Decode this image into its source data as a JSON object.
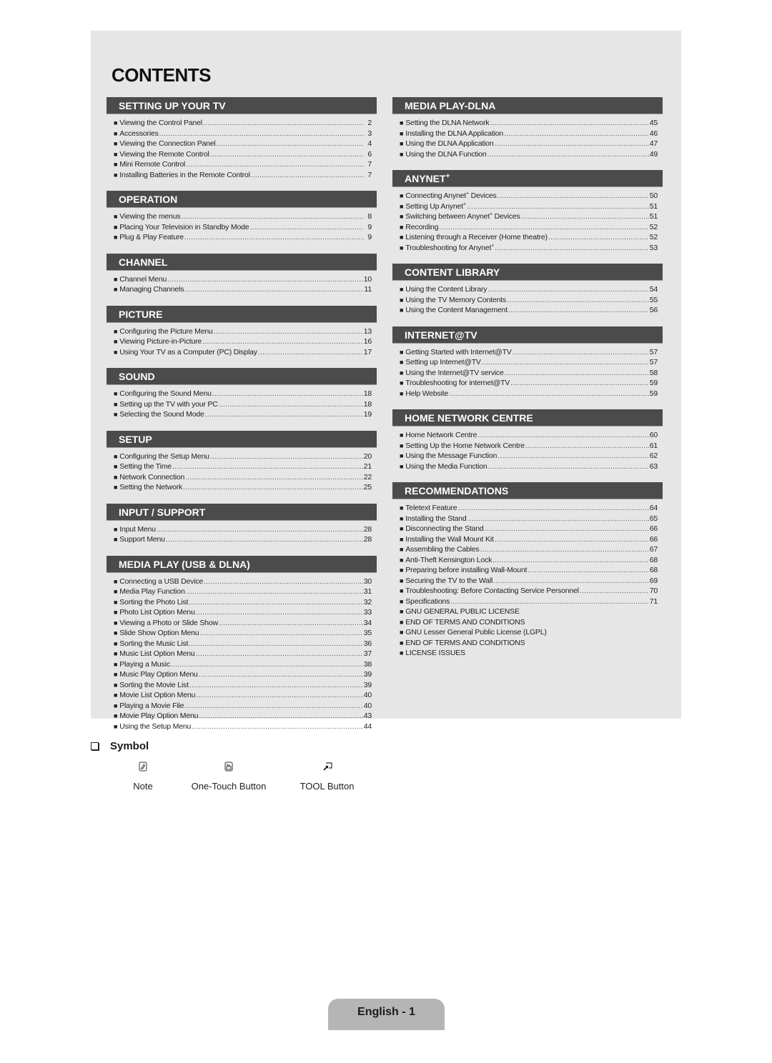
{
  "page_title": "CONTENTS",
  "bullet": "■",
  "left_column": [
    {
      "heading": "SETTING UP YOUR TV",
      "items": [
        {
          "label": "Viewing the Control Panel",
          "page": "2"
        },
        {
          "label": "Accessories",
          "page": "3"
        },
        {
          "label": "Viewing the Connection Panel",
          "page": "4"
        },
        {
          "label": "Viewing the Remote Control",
          "page": "6"
        },
        {
          "label": "Mini Remote Control",
          "page": "7"
        },
        {
          "label": "Installing Batteries in the Remote Control",
          "page": "7"
        }
      ]
    },
    {
      "heading": "OPERATION",
      "items": [
        {
          "label": "Viewing the menus",
          "page": "8"
        },
        {
          "label": "Placing Your Television in Standby Mode",
          "page": "9"
        },
        {
          "label": "Plug & Play Feature",
          "page": "9"
        }
      ]
    },
    {
      "heading": "CHANNEL",
      "items": [
        {
          "label": "Channel Menu",
          "page": "10"
        },
        {
          "label": "Managing Channels",
          "page": "11"
        }
      ]
    },
    {
      "heading": "PICTURE",
      "items": [
        {
          "label": "Configuring the Picture Menu",
          "page": "13"
        },
        {
          "label": "Viewing Picture-in-Picture",
          "page": "16"
        },
        {
          "label": "Using Your TV as a Computer (PC) Display",
          "page": "17"
        }
      ]
    },
    {
      "heading": "SOUND",
      "items": [
        {
          "label": "Configuring the Sound Menu",
          "page": "18"
        },
        {
          "label": "Setting up the TV with your PC",
          "page": "18"
        },
        {
          "label": "Selecting the Sound Mode",
          "page": "19"
        }
      ]
    },
    {
      "heading": "SETUP",
      "items": [
        {
          "label": "Configuring the Setup Menu",
          "page": "20"
        },
        {
          "label": "Setting the Time",
          "page": "21"
        },
        {
          "label": "Network Connection",
          "page": "22"
        },
        {
          "label": "Setting the Network",
          "page": "25"
        }
      ]
    },
    {
      "heading": "INPUT / SUPPORT",
      "items": [
        {
          "label": "Input Menu",
          "page": "28"
        },
        {
          "label": "Support Menu",
          "page": "28"
        }
      ]
    },
    {
      "heading": "MEDIA PLAY (USB & DLNA)",
      "items": [
        {
          "label": "Connecting a USB Device",
          "page": "30"
        },
        {
          "label": "Media Play Function",
          "page": "31"
        },
        {
          "label": "Sorting the Photo List",
          "page": "32"
        },
        {
          "label": "Photo List Option Menu",
          "page": "33"
        },
        {
          "label": "Viewing a Photo or Slide Show",
          "page": "34"
        },
        {
          "label": "Slide Show Option Menu",
          "page": "35"
        },
        {
          "label": "Sorting the Music List",
          "page": "36"
        },
        {
          "label": "Music List Option Menu",
          "page": "37"
        },
        {
          "label": "Playing a Music",
          "page": "38"
        },
        {
          "label": "Music Play Option Menu",
          "page": "39"
        },
        {
          "label": "Sorting the Movie List",
          "page": "39"
        },
        {
          "label": "Movie List Option Menu",
          "page": "40"
        },
        {
          "label": "Playing a Movie File",
          "page": "40"
        },
        {
          "label": "Movie Play Option Menu",
          "page": "43"
        },
        {
          "label": "Using the Setup Menu",
          "page": "44"
        }
      ]
    }
  ],
  "right_column": [
    {
      "heading": "MEDIA PLAY-DLNA",
      "items": [
        {
          "label": "Setting the DLNA Network",
          "page": "45"
        },
        {
          "label": "Installing the DLNA Application",
          "page": "46"
        },
        {
          "label": "Using the DLNA Application",
          "page": "47"
        },
        {
          "label": "Using the DLNA Function",
          "page": "49"
        }
      ]
    },
    {
      "heading": "ANYNET",
      "heading_sup": "+",
      "items": [
        {
          "label": "Connecting Anynet",
          "sup": "+",
          "suffix": " Devices",
          "page": "50"
        },
        {
          "label": "Setting Up Anynet",
          "sup": "+",
          "suffix": "",
          "page": "51"
        },
        {
          "label": "Switching between Anynet",
          "sup": "+",
          "suffix": " Devices",
          "page": "51"
        },
        {
          "label": "Recording",
          "page": "52"
        },
        {
          "label": "Listening through a Receiver (Home theatre)",
          "page": "52"
        },
        {
          "label": "Troubleshooting for Anynet",
          "sup": "+",
          "suffix": "",
          "page": "53"
        }
      ]
    },
    {
      "heading": "CONTENT LIBRARY",
      "items": [
        {
          "label": "Using the Content Library",
          "page": "54"
        },
        {
          "label": "Using the TV Memory Contents",
          "page": "55"
        },
        {
          "label": "Using the Content Management",
          "page": "56"
        }
      ]
    },
    {
      "heading": "INTERNET@TV",
      "items": [
        {
          "label": "Getting Started with Internet@TV",
          "page": "57"
        },
        {
          "label": "Setting up Internet@TV",
          "page": "57"
        },
        {
          "label": "Using the Internet@TV service",
          "page": "58"
        },
        {
          "label": "Troubleshooting for internet@TV",
          "page": "59"
        },
        {
          "label": "Help Website",
          "page": "59"
        }
      ]
    },
    {
      "heading": "HOME NETWORK CENTRE",
      "items": [
        {
          "label": "Home Network Centre",
          "page": "60"
        },
        {
          "label": "Setting Up the Home Network Centre",
          "page": "61"
        },
        {
          "label": "Using the Message Function",
          "page": "62"
        },
        {
          "label": "Using the Media Function",
          "page": "63"
        }
      ]
    },
    {
      "heading": "RECOMMENDATIONS",
      "items": [
        {
          "label": "Teletext Feature",
          "page": "64"
        },
        {
          "label": "Installing the Stand",
          "page": "65"
        },
        {
          "label": "Disconnecting the Stand",
          "page": "66"
        },
        {
          "label": "Installing the Wall Mount Kit",
          "page": "66"
        },
        {
          "label": "Assembling the Cables",
          "page": "67"
        },
        {
          "label": "Anti-Theft Kensington Lock",
          "page": "68"
        },
        {
          "label": "Preparing before installing Wall-Mount",
          "page": "68"
        },
        {
          "label": "Securing the TV to the Wall",
          "page": "69"
        },
        {
          "label": "Troubleshooting: Before Contacting Service Personnel",
          "page": "70"
        },
        {
          "label": "Specifications",
          "page": "71"
        },
        {
          "label": "GNU GENERAL PUBLIC LICENSE"
        },
        {
          "label": "END OF TERMS AND CONDITIONS"
        },
        {
          "label": "GNU Lesser General Public License (LGPL)"
        },
        {
          "label": "END OF TERMS AND CONDITIONS"
        },
        {
          "label": "LICENSE ISSUES"
        }
      ]
    }
  ],
  "symbol": {
    "heading": "Symbol",
    "items": [
      {
        "icon": "note-icon",
        "label": "Note"
      },
      {
        "icon": "one-touch-button-icon",
        "label": "One-Touch Button"
      },
      {
        "icon": "tool-button-icon",
        "label": "TOOL Button"
      }
    ]
  },
  "footer": {
    "page_label": "English - 1"
  }
}
